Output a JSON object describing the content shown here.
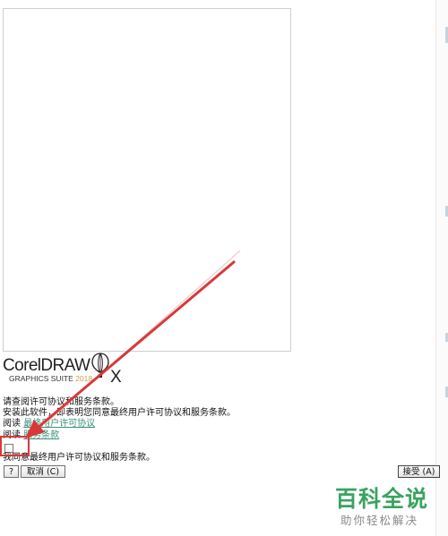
{
  "logo": {
    "wordmark": "CorelDRAW",
    "suite": "GRAPHICS SUITE ",
    "year": "2018",
    "x": "X",
    "balloon_icon": "balloon-icon"
  },
  "dialog": {
    "intro": "请查阅许可协议和服务条款。",
    "install_notice": "安装此软件，即表明您同意最终用户许可协议和服务条款。",
    "read_prefix_1": "阅读",
    "eula_link": "最终用户许可协议",
    "read_prefix_2": "阅读",
    "terms_link": "服务条款",
    "agree_label": "我同意最终用户许可协议和服务条款。",
    "help_button": "?",
    "cancel_button": "取消 (C)",
    "accept_button": "接受 (A)"
  },
  "colors": {
    "link": "#3a8f7a",
    "annotation": "#d9383a",
    "watermark": "#3aa35f"
  },
  "watermark": {
    "main": "百科全说",
    "sub": "助你轻松解决"
  }
}
